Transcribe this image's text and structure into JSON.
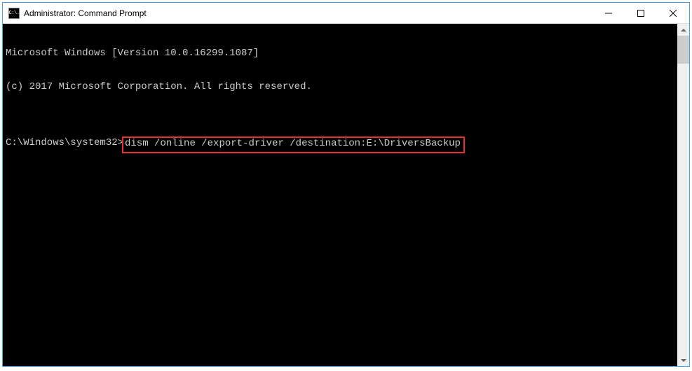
{
  "window": {
    "title": "Administrator: Command Prompt",
    "icon_text": "C:\\."
  },
  "console": {
    "line1": "Microsoft Windows [Version 10.0.16299.1087]",
    "line2": "(c) 2017 Microsoft Corporation. All rights reserved.",
    "blank": "",
    "prompt": "C:\\Windows\\system32>",
    "command": "dism /online /export-driver /destination:E:\\DriversBackup"
  }
}
